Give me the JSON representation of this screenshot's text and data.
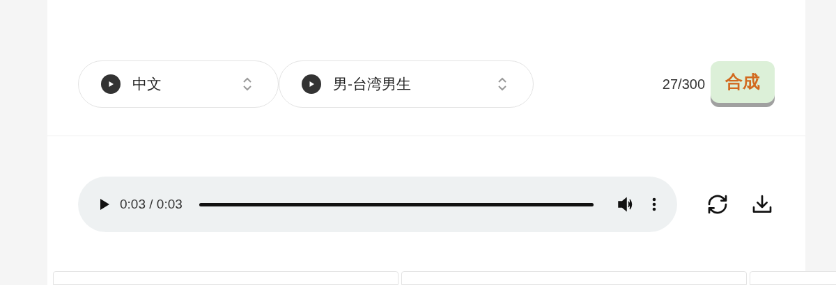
{
  "selectors": [
    {
      "label": "中文"
    },
    {
      "label": "男-台湾男生"
    }
  ],
  "char_count": "27/300",
  "synthesize_button": "合成",
  "audio_player": {
    "time": "0:03 / 0:03",
    "level": 1
  },
  "cards": [
    {
      "kind": "card"
    },
    {
      "kind": "card"
    },
    {
      "kind": "card"
    }
  ]
}
